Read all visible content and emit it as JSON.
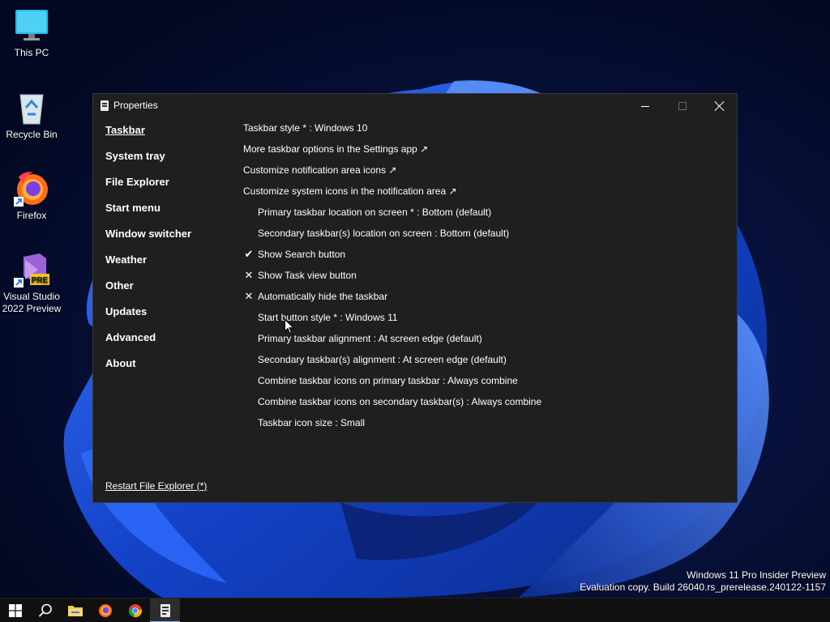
{
  "desktop": {
    "icons": [
      {
        "label": "This PC",
        "icon": "monitor-icon"
      },
      {
        "label": "Recycle Bin",
        "icon": "recycle-bin-icon"
      },
      {
        "label": "Firefox",
        "icon": "firefox-icon"
      },
      {
        "label_line1": "Visual Studio",
        "label_line2": "2022 Preview",
        "icon": "visual-studio-icon",
        "badge": "PRE"
      }
    ]
  },
  "window": {
    "title": "Properties",
    "nav": [
      {
        "label": "Taskbar",
        "active": true
      },
      {
        "label": "System tray"
      },
      {
        "label": "File Explorer"
      },
      {
        "label": "Start menu"
      },
      {
        "label": "Window switcher"
      },
      {
        "label": "Weather"
      },
      {
        "label": "Other"
      },
      {
        "label": "Updates"
      },
      {
        "label": "Advanced"
      },
      {
        "label": "About"
      }
    ],
    "restart_link": "Restart File Explorer (*)",
    "settings": [
      {
        "text": "Taskbar style * : Windows 10"
      },
      {
        "text": "More taskbar options in the Settings app ↗"
      },
      {
        "text": "Customize notification area icons ↗"
      },
      {
        "text": "Customize system icons in the notification area ↗"
      },
      {
        "text": "Primary taskbar location on screen * : Bottom (default)"
      },
      {
        "text": "Secondary taskbar(s) location on screen : Bottom (default)"
      },
      {
        "text": "Show Search button",
        "mark": "✔"
      },
      {
        "text": "Show Task view button",
        "mark": "✕"
      },
      {
        "text": "Automatically hide the taskbar",
        "mark": "✕"
      },
      {
        "text": "Start button style * : Windows 11"
      },
      {
        "text": "Primary taskbar alignment : At screen edge (default)"
      },
      {
        "text": "Secondary taskbar(s) alignment : At screen edge (default)"
      },
      {
        "text": "Combine taskbar icons on primary taskbar : Always combine"
      },
      {
        "text": "Combine taskbar icons on secondary taskbar(s) : Always combine"
      },
      {
        "text": "Taskbar icon size : Small"
      }
    ]
  },
  "watermark": {
    "line1": "Windows 11 Pro Insider Preview",
    "line2": "Evaluation copy. Build 26040.rs_prerelease.240122-1157"
  },
  "taskbar": {
    "items": [
      {
        "icon": "windows-start-icon"
      },
      {
        "icon": "search-icon"
      },
      {
        "icon": "file-explorer-icon"
      },
      {
        "icon": "firefox-icon"
      },
      {
        "icon": "chrome-icon"
      },
      {
        "icon": "properties-app-icon",
        "active": true
      }
    ]
  },
  "colors": {
    "window_bg": "#1f1f1f",
    "wallpaper_dark": "#040c2a",
    "wallpaper_blue": "#1a4fd6"
  }
}
